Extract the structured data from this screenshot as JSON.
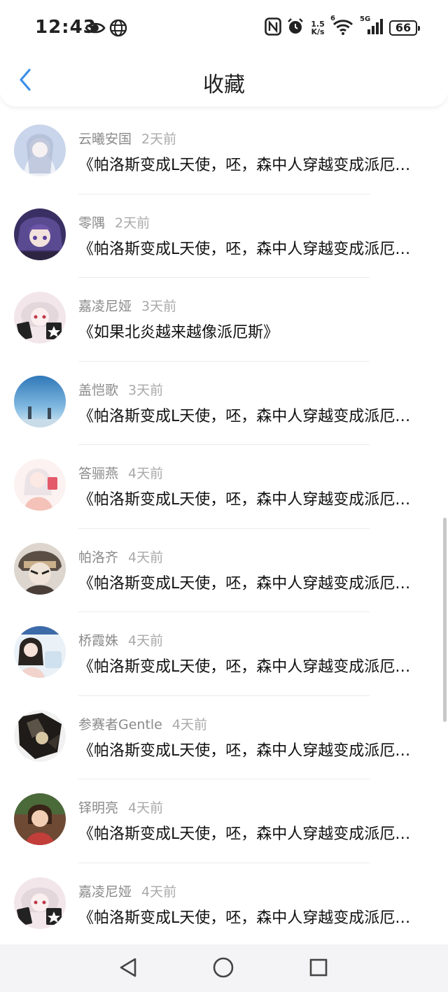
{
  "status_bar": {
    "time": "12:43",
    "net_speed_value": "1.5",
    "net_speed_unit": "K/s",
    "battery_level": "66",
    "wifi_badge": "6",
    "signal_label": "5G"
  },
  "header": {
    "title": "收藏"
  },
  "items": [
    {
      "user": "云曦安国",
      "time": "2天前",
      "title": "《帕洛斯变成L天使，呸，森中人穿越变成派厄斯》",
      "avatar_color": "#b9c6de"
    },
    {
      "user": "零隅",
      "time": "2天前",
      "title": "《帕洛斯变成L天使，呸，森中人穿越变成派厄斯》",
      "avatar_color": "#4b3b78"
    },
    {
      "user": "嘉凌尼娅",
      "time": "3天前",
      "title": "《如果北炎越来越像派厄斯》",
      "avatar_color": "#e8d8dc"
    },
    {
      "user": "盖恺歌",
      "time": "3天前",
      "title": "《帕洛斯变成L天使，呸，森中人穿越变成派厄斯》",
      "avatar_color": "#4c8fc3"
    },
    {
      "user": "答骊燕",
      "time": "4天前",
      "title": "《帕洛斯变成L天使，呸，森中人穿越变成派厄斯》",
      "avatar_color": "#f3dede"
    },
    {
      "user": "帕洛齐",
      "time": "4天前",
      "title": "《帕洛斯变成L天使，呸，森中人穿越变成派厄斯》",
      "avatar_color": "#6a5e55"
    },
    {
      "user": "桥霞姝",
      "time": "4天前",
      "title": "《帕洛斯变成L天使，呸，森中人穿越变成派厄斯》",
      "avatar_color": "#dce8f2"
    },
    {
      "user": "参赛者Gentle",
      "time": "4天前",
      "title": "《帕洛斯变成L天使，呸，森中人穿越变成派厄斯》",
      "avatar_color": "#2a2620"
    },
    {
      "user": "铎明亮",
      "time": "4天前",
      "title": "《帕洛斯变成L天使，呸，森中人穿越变成派厄斯》",
      "avatar_color": "#8a5a3c"
    },
    {
      "user": "嘉凌尼娅",
      "time": "4天前",
      "title": "《帕洛斯变成L天使，呸，森中人穿越变成派厄斯》",
      "avatar_color": "#e8d8dc"
    }
  ],
  "icons": {
    "back": "chevron-left-icon",
    "eye": "eye-icon",
    "globe": "globe-icon",
    "nfc": "nfc-icon",
    "alarm": "alarm-icon",
    "wifi": "wifi-icon",
    "signal": "signal-icon",
    "nav_back": "triangle-back-icon",
    "nav_home": "circle-home-icon",
    "nav_recents": "square-recents-icon"
  },
  "colors": {
    "accent": "#3d8fe8",
    "username": "#8a8a8a",
    "timestamp": "#a9a9a9"
  }
}
